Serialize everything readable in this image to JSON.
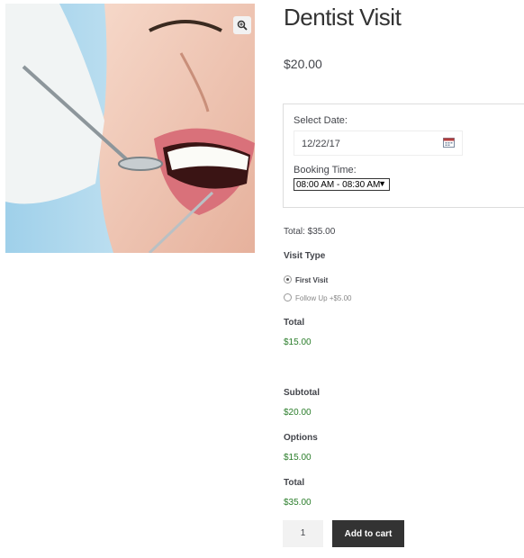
{
  "product": {
    "title": "Dentist Visit",
    "price": "$20.00"
  },
  "image": {
    "icon": "magnifier-plus-icon"
  },
  "booking": {
    "date_label": "Select Date:",
    "date_value": "12/22/17",
    "time_label": "Booking Time:",
    "time_value": "08:00 AM - 08:30 AM"
  },
  "total_line": "Total: $35.00",
  "visit_type": {
    "heading": "Visit Type",
    "options": [
      {
        "label": "First Visit",
        "extra": "",
        "selected": true
      },
      {
        "label": "Follow Up",
        "extra": "+$5.00",
        "selected": false
      }
    ],
    "total_heading": "Total",
    "total_value": "$15.00"
  },
  "summary": {
    "subtotal_label": "Subtotal",
    "subtotal_value": "$20.00",
    "options_label": "Options",
    "options_value": "$15.00",
    "total_label": "Total",
    "total_value": "$35.00"
  },
  "cart": {
    "quantity": "1",
    "button_label": "Add to cart"
  }
}
